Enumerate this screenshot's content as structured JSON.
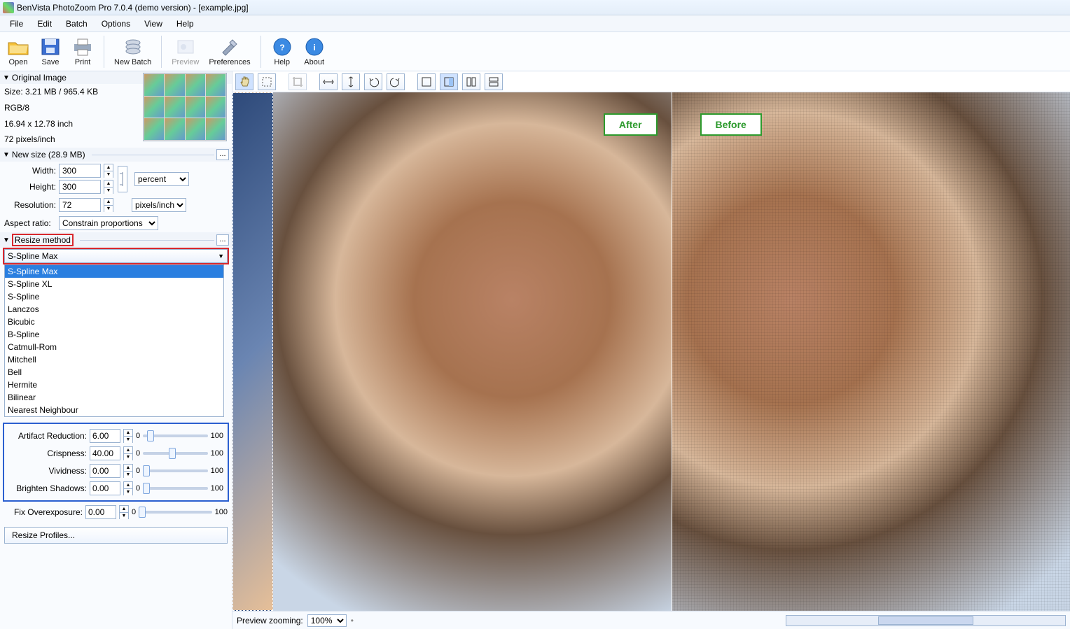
{
  "window": {
    "title": "BenVista PhotoZoom Pro 7.0.4 (demo version) - [example.jpg]"
  },
  "menu": [
    "File",
    "Edit",
    "Batch",
    "Options",
    "View",
    "Help"
  ],
  "tools": {
    "open": "Open",
    "save": "Save",
    "print": "Print",
    "newbatch": "New Batch",
    "preview": "Preview",
    "preferences": "Preferences",
    "help": "Help",
    "about": "About"
  },
  "orig": {
    "header": "Original Image",
    "size": "Size: 3.21 MB / 965.4 KB",
    "depth": "RGB/8",
    "inches": "16.94 x 12.78 inch",
    "ppi": "72 pixels/inch"
  },
  "newsize": {
    "header": "New size (28.9 MB)",
    "width_lbl": "Width:",
    "width": "300",
    "height_lbl": "Height:",
    "height": "300",
    "unit": "percent",
    "res_lbl": "Resolution:",
    "res": "72",
    "res_unit": "pixels/inch",
    "aspect_lbl": "Aspect ratio:",
    "aspect": "Constrain proportions"
  },
  "resize": {
    "header": "Resize method",
    "current": "S-Spline Max",
    "options": [
      "S-Spline Max",
      "S-Spline XL",
      "S-Spline",
      "Lanczos",
      "Bicubic",
      "B-Spline",
      "Catmull-Rom",
      "Mitchell",
      "Bell",
      "Hermite",
      "Bilinear",
      "Nearest Neighbour"
    ]
  },
  "params": {
    "artifact_lbl": "Artifact Reduction:",
    "artifact": "6.00",
    "crisp_lbl": "Crispness:",
    "crisp": "40.00",
    "vivid_lbl": "Vividness:",
    "vivid": "0.00",
    "brighten_lbl": "Brighten Shadows:",
    "brighten": "0.00",
    "fixover_lbl": "Fix Overexposure:",
    "fixover": "0.00",
    "min": "0",
    "max": "100"
  },
  "resize_profiles": "Resize Profiles...",
  "badges": {
    "after": "After",
    "before": "Before"
  },
  "status": {
    "label": "Preview zooming:",
    "zoom": "100%"
  },
  "ellipsis": "...",
  "dot": "•"
}
